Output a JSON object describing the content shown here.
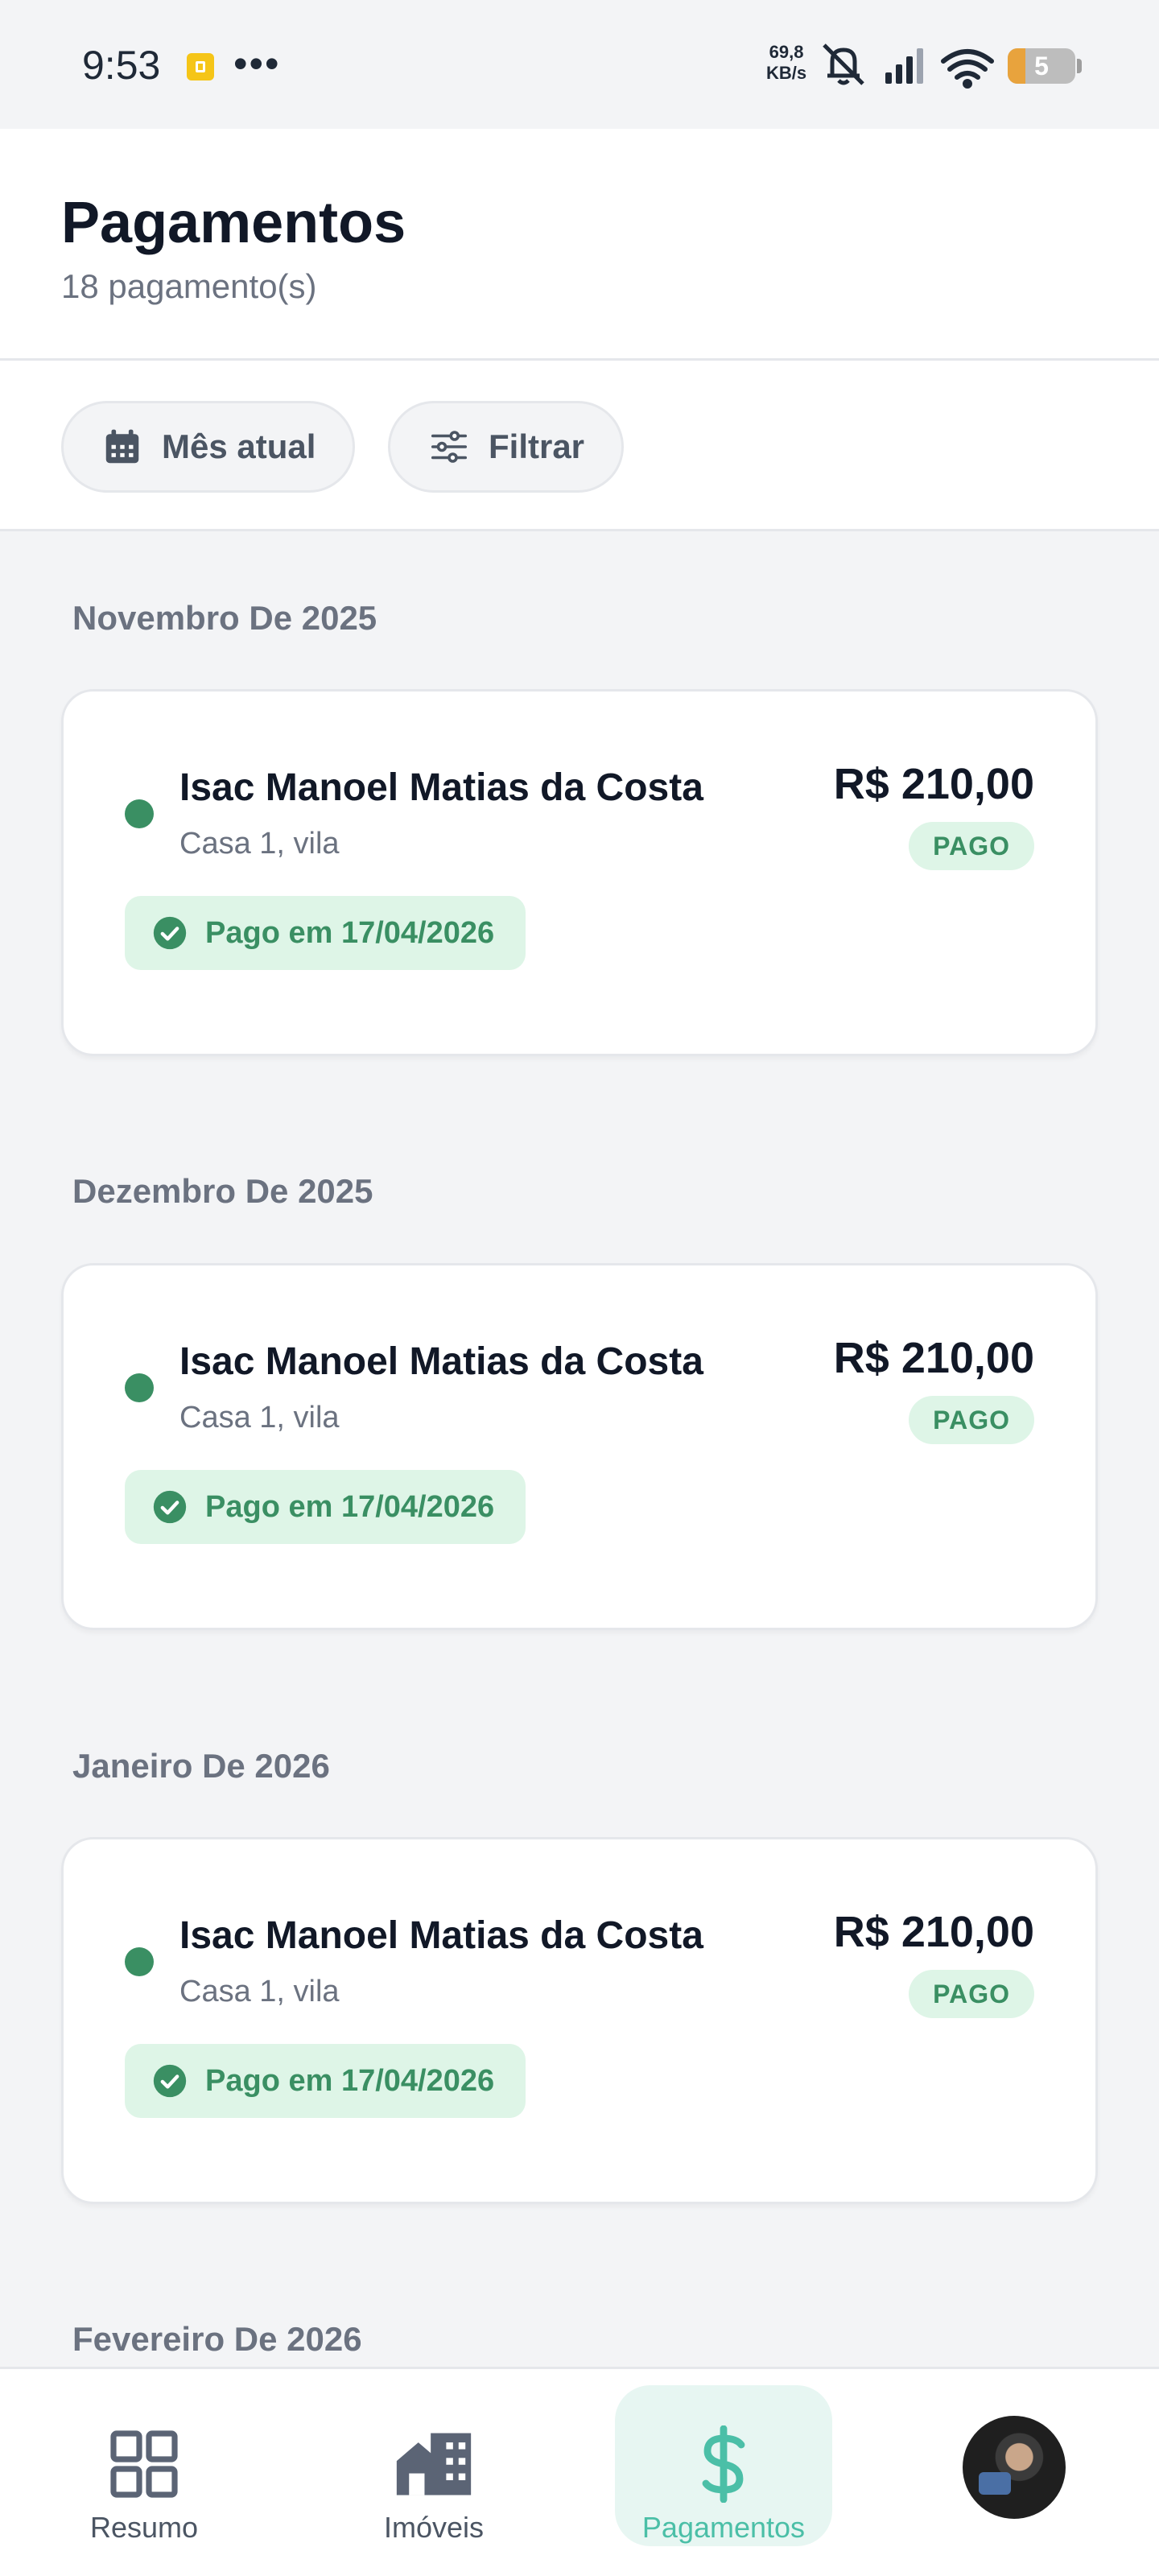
{
  "status_bar": {
    "time": "9:53",
    "dots": "•••",
    "speed_value": "69,8",
    "speed_unit": "KB/s",
    "battery": "5"
  },
  "header": {
    "title": "Pagamentos",
    "subtitle": "18 pagamento(s)"
  },
  "filters": {
    "month_label": "Mês atual",
    "filter_label": "Filtrar"
  },
  "sections": [
    {
      "title": "Novembro De 2025",
      "payment": {
        "tenant": "Isac Manoel Matias da Costa",
        "property": "Casa 1, vila",
        "amount": "R$ 210,00",
        "status": "PAGO",
        "paid_on": "Pago em 17/04/2026"
      }
    },
    {
      "title": "Dezembro De 2025",
      "payment": {
        "tenant": "Isac Manoel Matias da Costa",
        "property": "Casa 1, vila",
        "amount": "R$ 210,00",
        "status": "PAGO",
        "paid_on": "Pago em 17/04/2026"
      }
    },
    {
      "title": "Janeiro De 2026",
      "payment": {
        "tenant": "Isac Manoel Matias da Costa",
        "property": "Casa 1, vila",
        "amount": "R$ 210,00",
        "status": "PAGO",
        "paid_on": "Pago em 17/04/2026"
      }
    },
    {
      "title": "Fevereiro De 2026"
    }
  ],
  "bottom_nav": {
    "items": [
      {
        "label": "Resumo",
        "icon": "grid-icon"
      },
      {
        "label": "Imóveis",
        "icon": "buildings-icon"
      },
      {
        "label": "Pagamentos",
        "icon": "dollar-icon",
        "active": true
      },
      {
        "label": "",
        "icon": "avatar"
      }
    ]
  },
  "colors": {
    "accent": "#4bbfa7",
    "paid_green": "#3a8f63",
    "paid_bg": "#def5e7",
    "background": "#f3f4f6"
  }
}
